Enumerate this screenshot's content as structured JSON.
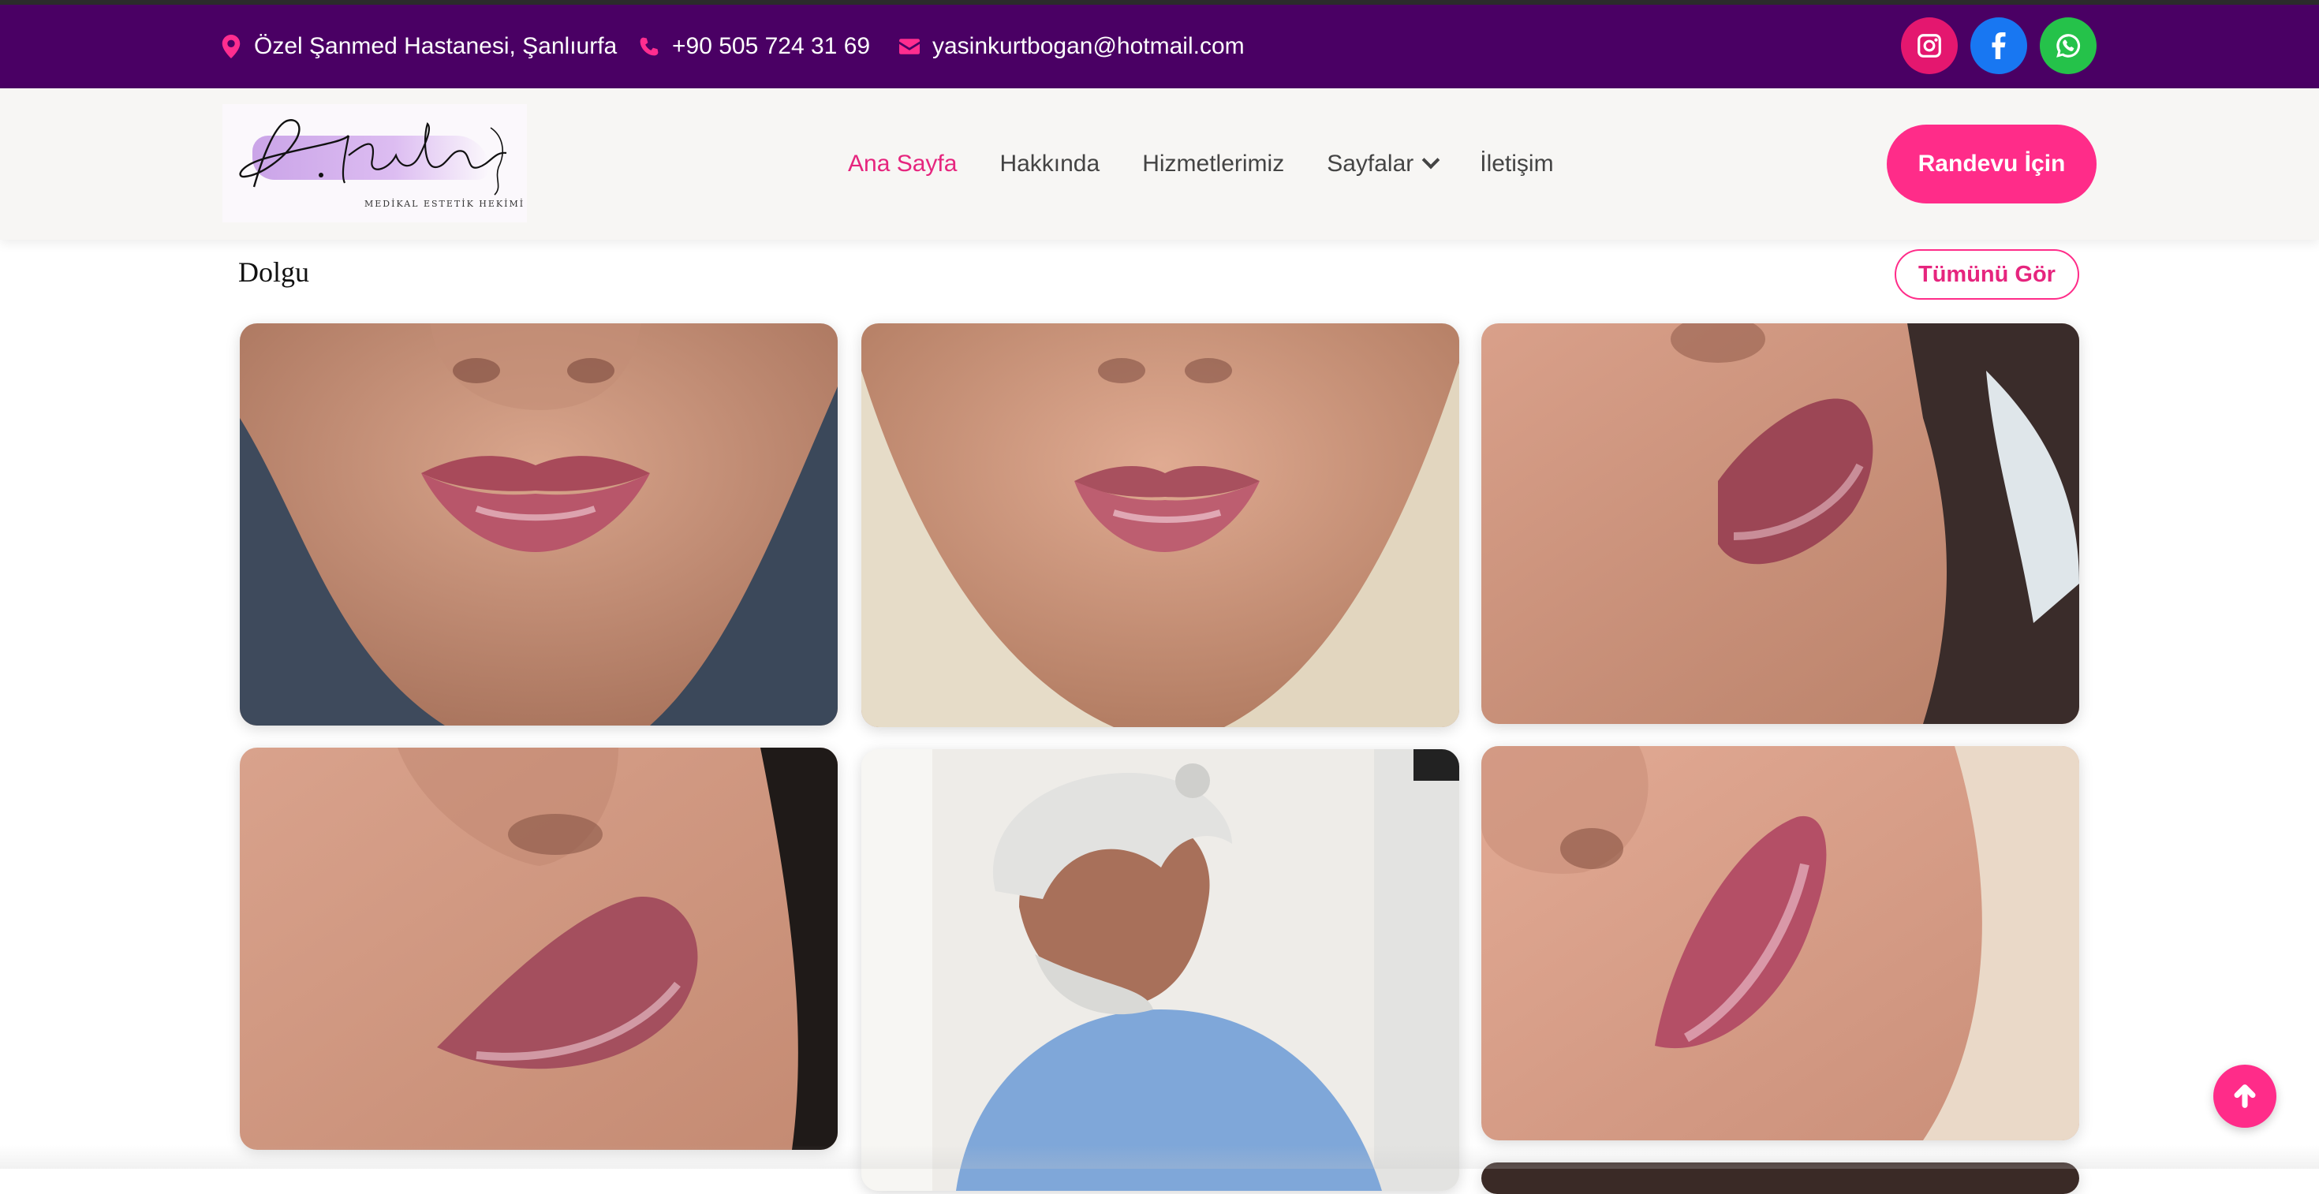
{
  "topbar": {
    "address": "Özel Şanmed Hastanesi, Şanlıurfa",
    "phone": "+90 505 724 31 69",
    "email": "yasinkurtbogan@hotmail.com",
    "socials": [
      "instagram-icon",
      "facebook-icon",
      "whatsapp-icon"
    ],
    "bg_color": "#4a0064",
    "icon_color": "#ff2d8f"
  },
  "logo": {
    "script_text": "Dr. Kurtboğan",
    "tagline": "MEDİKAL ESTETİK HEKİMİ"
  },
  "nav": {
    "items": [
      {
        "label": "Ana Sayfa",
        "active": true
      },
      {
        "label": "Hakkında"
      },
      {
        "label": "Hizmetlerimiz"
      },
      {
        "label": "Sayfalar",
        "dropdown": true
      },
      {
        "label": "İletişim"
      }
    ],
    "cta_label": "Randevu İçin"
  },
  "gallery": {
    "title": "Dolgu",
    "view_all_label": "Tümünü Gör"
  },
  "colors": {
    "accent": "#ff2c89",
    "active_link": "#e6257e"
  }
}
